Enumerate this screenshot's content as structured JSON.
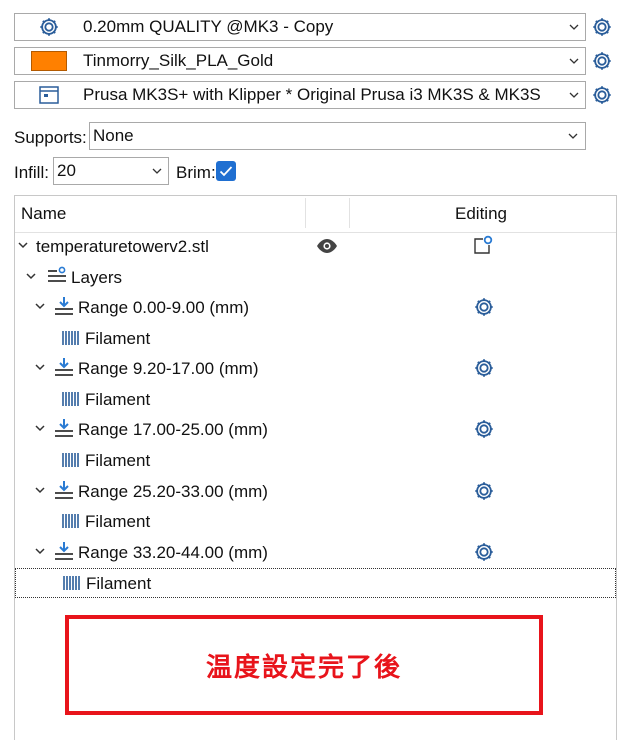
{
  "presets": {
    "print": "0.20mm QUALITY @MK3 - Copy",
    "filament": "Tinmorry_Silk_PLA_Gold",
    "filament_color": "#ff8000",
    "printer": "Prusa MK3S+ with Klipper * Original Prusa i3 MK3S & MK3S"
  },
  "options": {
    "supports_label": "Supports:",
    "supports_value": "None",
    "infill_label": "Infill:",
    "infill_value": "20",
    "brim_label": "Brim:",
    "brim_checked": true
  },
  "tree": {
    "col_name": "Name",
    "col_editing": "Editing",
    "object": "temperaturetowerv2.stl",
    "layers": "Layers",
    "ranges": [
      {
        "label": "Range 0.00-9.00 (mm)",
        "child": "Filament"
      },
      {
        "label": "Range 9.20-17.00 (mm)",
        "child": "Filament"
      },
      {
        "label": "Range 17.00-25.00 (mm)",
        "child": "Filament"
      },
      {
        "label": "Range 25.20-33.00 (mm)",
        "child": "Filament"
      },
      {
        "label": "Range 33.20-44.00 (mm)",
        "child": "Filament"
      }
    ]
  },
  "annotation": "温度設定完了後",
  "colors": {
    "accent": "#1f6fd1",
    "annotation": "#e8141b"
  }
}
